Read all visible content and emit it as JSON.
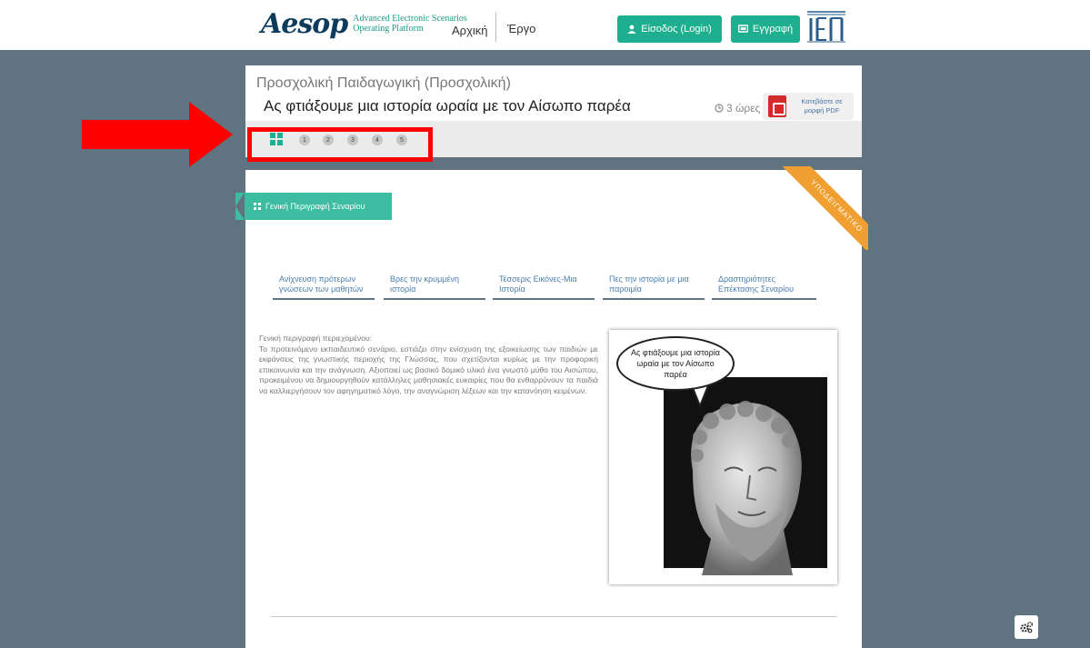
{
  "header": {
    "logo_word": "Aesop",
    "logo_sub_line1": "Advanced Electronic Scenarios",
    "logo_sub_line2": "Operating Platform",
    "nav_home": "Αρχική",
    "nav_work": "Έργο",
    "login_label": "Είσοδος (Login)",
    "register_label": "Εγγραφή",
    "brand_logo_text": "ΙΕΠ"
  },
  "scenario": {
    "category": "Προσχολική Παιδαγωγική (Προσχολική)",
    "title": "Ας φτιάξουμε μια ιστορία ωραία με τον Αίσωπο παρέα",
    "duration": "3 ώρες",
    "pdf_label_line1": "Κατεβάστε σε",
    "pdf_label_line2": "μορφή PDF",
    "steps": [
      "1",
      "2",
      "3",
      "4",
      "5"
    ],
    "ribbon_text": "ΥΠΟΔΕΙΓΜΑΤΙΚΟ"
  },
  "content": {
    "general_tag": "Γενική Περιγραφή Σεναρίου",
    "tabs": [
      {
        "label": "Ανίχνευση πρότερων γνώσεων των μαθητών"
      },
      {
        "label": "Βρες την κρυμμένη ιστορία"
      },
      {
        "label": "Τέσσερις Εικόνες-Μια Ιστορία"
      },
      {
        "label": "Πες την ιστορία με μια παροιμία"
      },
      {
        "label": "Δραστηριότητες Επέκτασης Σεναρίου"
      }
    ],
    "description_heading": "Γενική περιγραφή περιεχομένου:",
    "description_body": "Το προτεινόμενο εκπαιδευτικό σενάριο, εστιάζει στην ενίσχυση της εξοικείωσης των παιδιών με εκφάνσεις της γνωστικής περιοχής της Γλώσσας, που σχετίζονται κυρίως με την προφορική επικοινωνία και την ανάγνωση. Αξιοποιεί ως βασικό δομικό υλικό ένα γνωστό μύθο του Αισώπου, προκειμένου να δημιουργηθούν κατάλληλες μαθησιακές ευκαιρίες που θα ενθαρρύνουν τα παιδιά να καλλιεργήσουν τον αφηγηματικό λόγο, την αναγνώριση λέξεων και την κατανόηση κειμένων.",
    "speech_bubble": "Ας φτιάξουμε μια ιστορία ωραία με τον Αίσωπο παρέα"
  },
  "colors": {
    "accent": "#1daf8f",
    "background": "#5f7380",
    "ribbon": "#f0a030",
    "annotation": "#ff0000"
  }
}
